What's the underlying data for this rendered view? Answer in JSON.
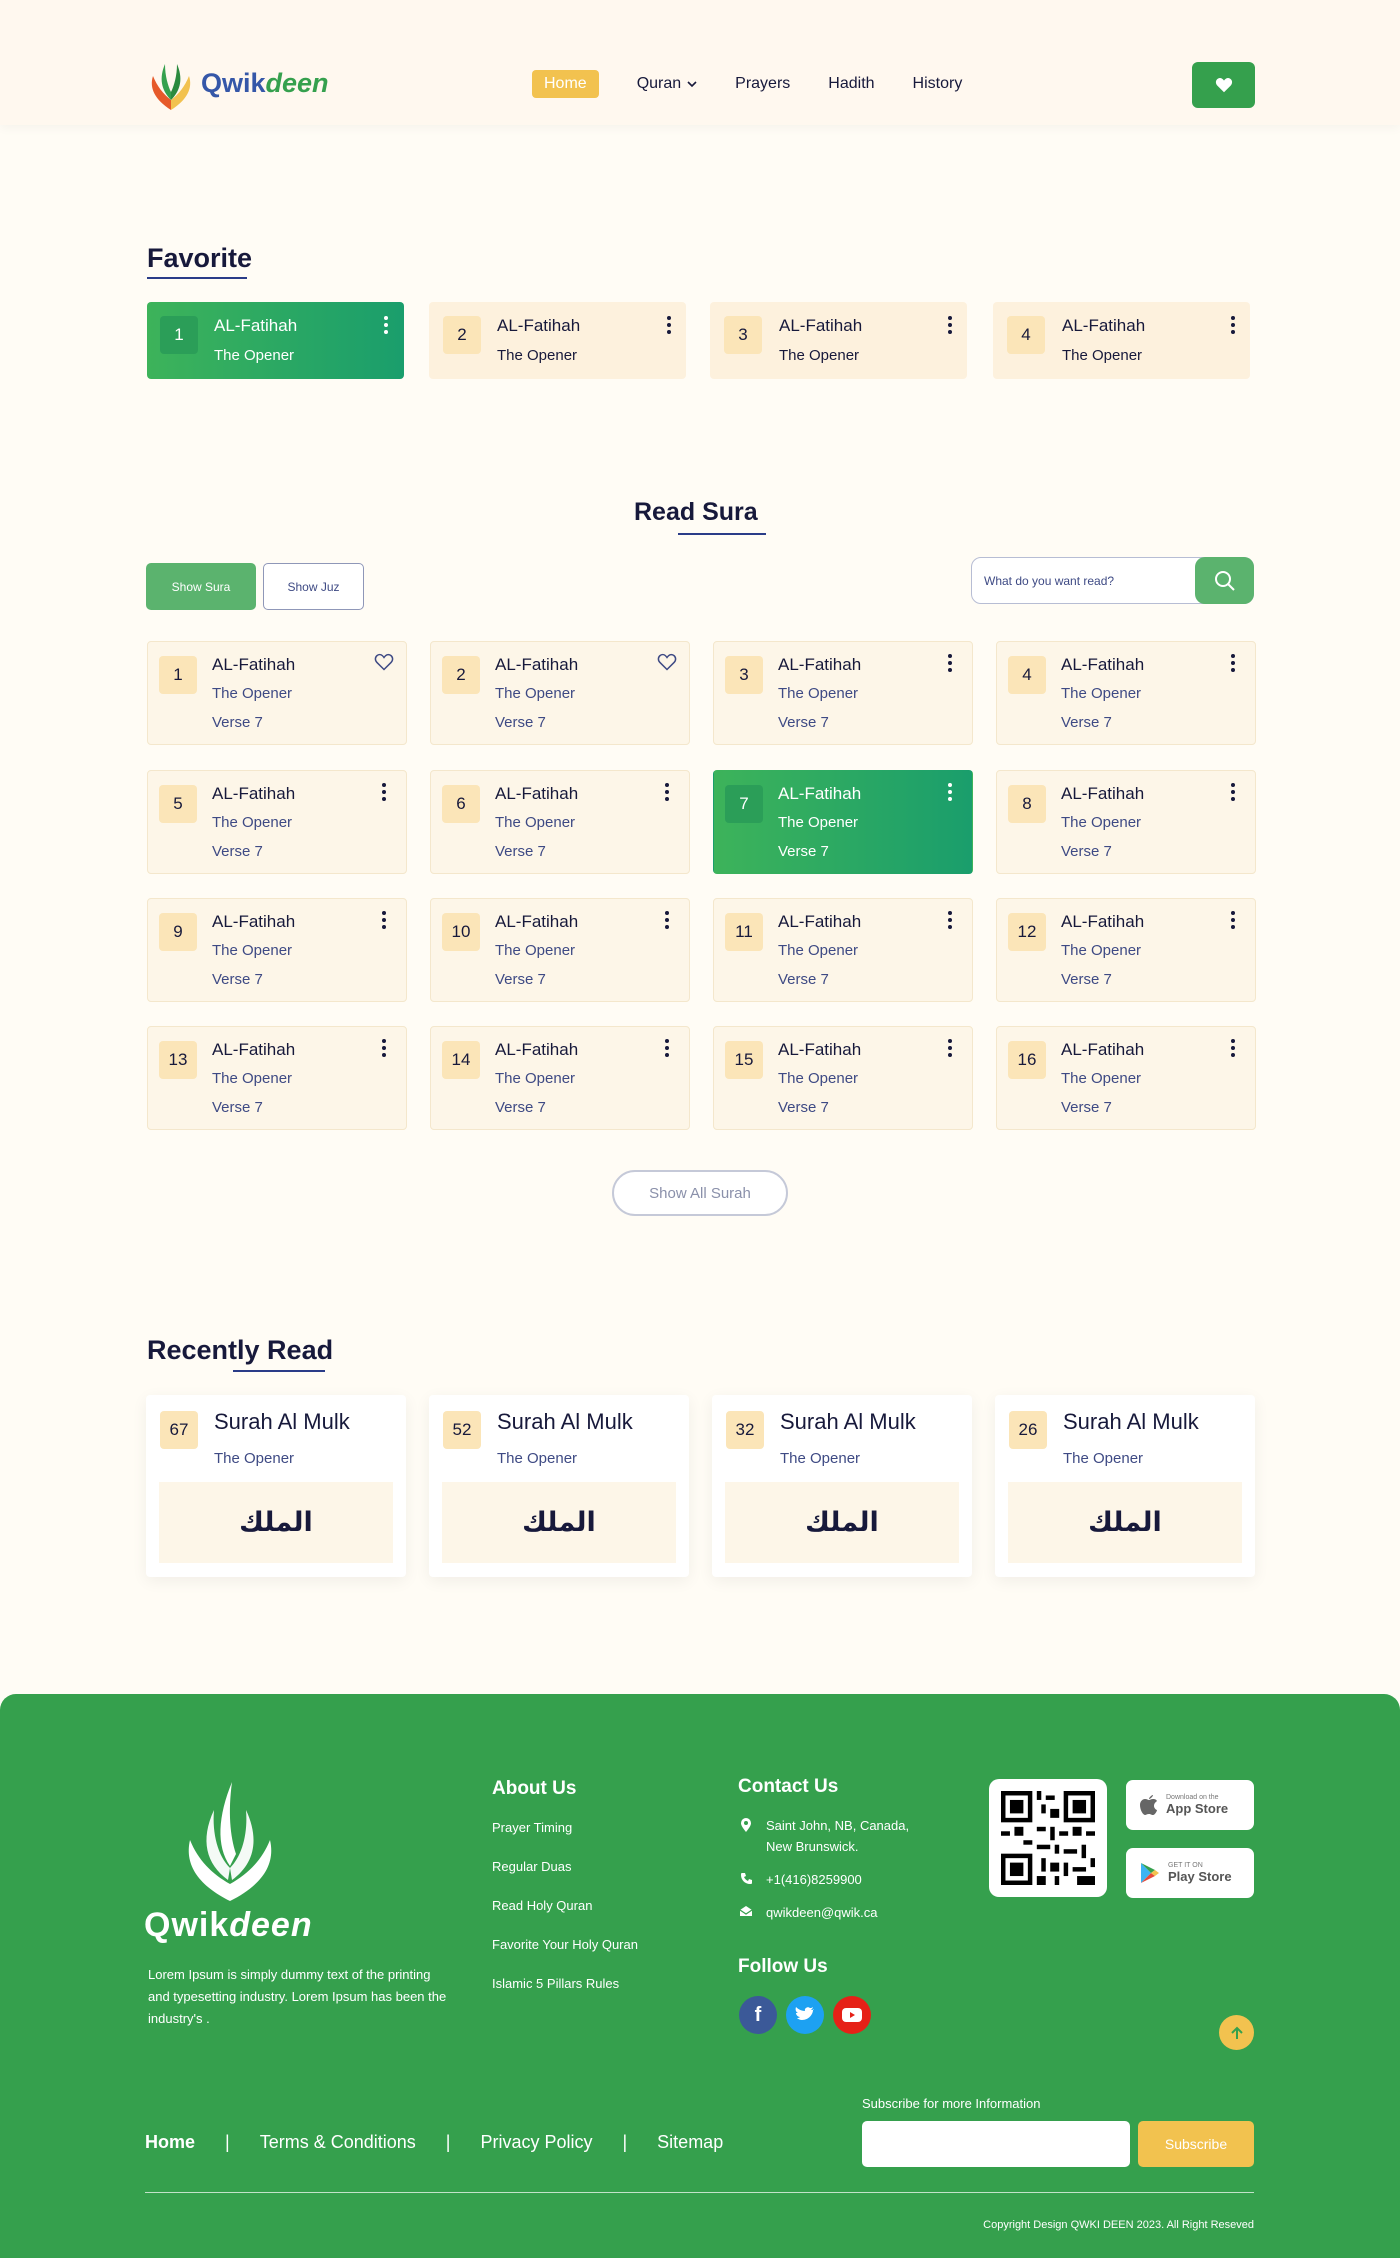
{
  "header": {
    "logo_primary": "Qwik",
    "logo_secondary": "deen",
    "nav": [
      {
        "label": "Home",
        "active": true
      },
      {
        "label": "Quran",
        "has_dropdown": true
      },
      {
        "label": "Prayers"
      },
      {
        "label": "Hadith"
      },
      {
        "label": "History"
      }
    ]
  },
  "favorite": {
    "title": "Favorite",
    "cards": [
      {
        "num": "1",
        "title": "AL-Fatihah",
        "subtitle": "The Opener",
        "active": true
      },
      {
        "num": "2",
        "title": "AL-Fatihah",
        "subtitle": "The Opener"
      },
      {
        "num": "3",
        "title": "AL-Fatihah",
        "subtitle": "The Opener"
      },
      {
        "num": "4",
        "title": "AL-Fatihah",
        "subtitle": "The Opener"
      }
    ]
  },
  "read_sura": {
    "title": "Read Sura",
    "tab_sura": "Show Sura",
    "tab_juz": "Show Juz",
    "search_placeholder": "What do you want read?",
    "show_all": "Show All Surah",
    "cards": [
      {
        "num": "1",
        "title": "AL-Fatihah",
        "subtitle": "The Opener",
        "verse": "Verse 7",
        "icon": "heart"
      },
      {
        "num": "2",
        "title": "AL-Fatihah",
        "subtitle": "The Opener",
        "verse": "Verse 7",
        "icon": "heart"
      },
      {
        "num": "3",
        "title": "AL-Fatihah",
        "subtitle": "The Opener",
        "verse": "Verse 7",
        "icon": "dots"
      },
      {
        "num": "4",
        "title": "AL-Fatihah",
        "subtitle": "The Opener",
        "verse": "Verse 7",
        "icon": "dots"
      },
      {
        "num": "5",
        "title": "AL-Fatihah",
        "subtitle": "The Opener",
        "verse": "Verse 7",
        "icon": "dots"
      },
      {
        "num": "6",
        "title": "AL-Fatihah",
        "subtitle": "The Opener",
        "verse": "Verse 7",
        "icon": "dots"
      },
      {
        "num": "7",
        "title": "AL-Fatihah",
        "subtitle": "The Opener",
        "verse": "Verse 7",
        "icon": "dots",
        "active": true
      },
      {
        "num": "8",
        "title": "AL-Fatihah",
        "subtitle": "The Opener",
        "verse": "Verse 7",
        "icon": "dots"
      },
      {
        "num": "9",
        "title": "AL-Fatihah",
        "subtitle": "The Opener",
        "verse": "Verse 7",
        "icon": "dots"
      },
      {
        "num": "10",
        "title": "AL-Fatihah",
        "subtitle": "The Opener",
        "verse": "Verse 7",
        "icon": "dots"
      },
      {
        "num": "11",
        "title": "AL-Fatihah",
        "subtitle": "The Opener",
        "verse": "Verse 7",
        "icon": "dots"
      },
      {
        "num": "12",
        "title": "AL-Fatihah",
        "subtitle": "The Opener",
        "verse": "Verse 7",
        "icon": "dots"
      },
      {
        "num": "13",
        "title": "AL-Fatihah",
        "subtitle": "The Opener",
        "verse": "Verse 7",
        "icon": "dots"
      },
      {
        "num": "14",
        "title": "AL-Fatihah",
        "subtitle": "The Opener",
        "verse": "Verse 7",
        "icon": "dots"
      },
      {
        "num": "15",
        "title": "AL-Fatihah",
        "subtitle": "The Opener",
        "verse": "Verse 7",
        "icon": "dots"
      },
      {
        "num": "16",
        "title": "AL-Fatihah",
        "subtitle": "The Opener",
        "verse": "Verse 7",
        "icon": "dots"
      }
    ]
  },
  "recently_read": {
    "title": "Recently Read",
    "cards": [
      {
        "num": "67",
        "title": "Surah Al Mulk",
        "subtitle": "The Opener",
        "arabic": "الملك"
      },
      {
        "num": "52",
        "title": "Surah Al Mulk",
        "subtitle": "The Opener",
        "arabic": "الملك"
      },
      {
        "num": "32",
        "title": "Surah Al Mulk",
        "subtitle": "The Opener",
        "arabic": "الملك"
      },
      {
        "num": "26",
        "title": "Surah Al Mulk",
        "subtitle": "The Opener",
        "arabic": "الملك"
      }
    ]
  },
  "footer": {
    "logo_primary": "Qwik",
    "logo_secondary": "deen",
    "description": "Lorem Ipsum is simply dummy text of the printing and typesetting industry.  Lorem Ipsum has been the industry's .",
    "about_title": "About Us",
    "about_links": [
      "Prayer Timing",
      "Regular Duas",
      "Read Holy Quran",
      "Favorite Your Holy Quran",
      "Islamic 5 Pillars Rules"
    ],
    "contact_title": "Contact Us",
    "address": "Saint John, NB, Canada, New Brunswick.",
    "phone": "+1(416)8259900",
    "email": "qwikdeen@qwik.ca",
    "follow_title": "Follow Us",
    "social": [
      "facebook-icon",
      "twitter-icon",
      "youtube-icon"
    ],
    "app_store_small": "Download on the",
    "app_store": "App Store",
    "play_store_small": "GET IT ON",
    "play_store": "Play Store",
    "bottom_links": [
      "Home",
      "Terms & Conditions",
      "Privacy Policy",
      "Sitemap"
    ],
    "subscribe_label": "Subscribe for more Information",
    "subscribe_button": "Subscribe",
    "copyright": "Copyright Design QWKI DEEN 2023.  All Right Reseved"
  },
  "colors": {
    "brand_green": "#35a04d",
    "accent_yellow": "#f2c24f",
    "navy": "#17193b"
  }
}
